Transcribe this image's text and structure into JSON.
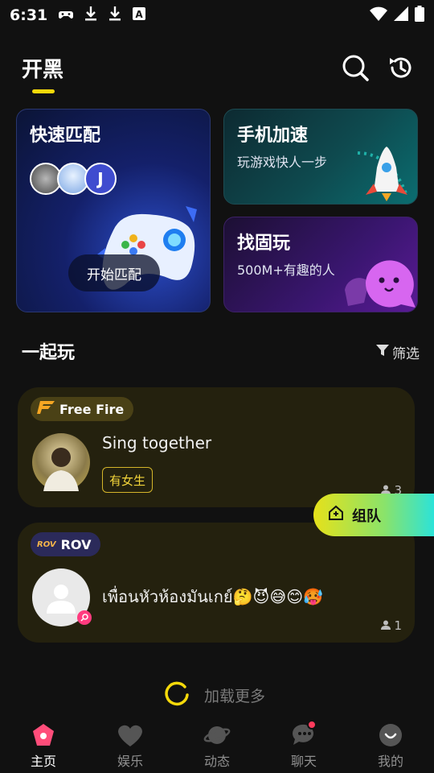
{
  "status_bar": {
    "time": "6:31",
    "icons_left": [
      "game-controller-icon",
      "download-icon",
      "download-icon",
      "font-a-icon"
    ],
    "icons_right": [
      "wifi-icon",
      "signal-icon",
      "battery-icon"
    ]
  },
  "header": {
    "title": "开黑",
    "icons": [
      "search-icon",
      "history-icon"
    ]
  },
  "cards": {
    "quick_match": {
      "title": "快速匹配",
      "avatar_letter": "J",
      "button": "开始匹配"
    },
    "speedup": {
      "title": "手机加速",
      "subtitle": "玩游戏快人一步"
    },
    "find_friends": {
      "title": "找固玩",
      "subtitle": "500M+有趣的人"
    }
  },
  "section": {
    "title": "一起玩",
    "filter": "筛选"
  },
  "rooms": [
    {
      "game": "Free Fire",
      "name": "Sing together",
      "badge": "有女生",
      "count": "3"
    },
    {
      "game": "ROV",
      "game_logo_text": "ROV",
      "name": "เพื่อนหัวห้องมันเกย์🤔😈😅😊🥵",
      "count": "1"
    }
  ],
  "team_button": "组队",
  "loading_text": "加载更多",
  "nav": [
    {
      "label": "主页",
      "icon": "home-icon",
      "active": true
    },
    {
      "label": "娱乐",
      "icon": "entertainment-icon"
    },
    {
      "label": "动态",
      "icon": "planet-icon"
    },
    {
      "label": "聊天",
      "icon": "chat-icon"
    },
    {
      "label": "我的",
      "icon": "profile-icon"
    }
  ],
  "colors": {
    "accent": "#f5d90a",
    "background": "#111111",
    "room_card": "#24210e"
  }
}
